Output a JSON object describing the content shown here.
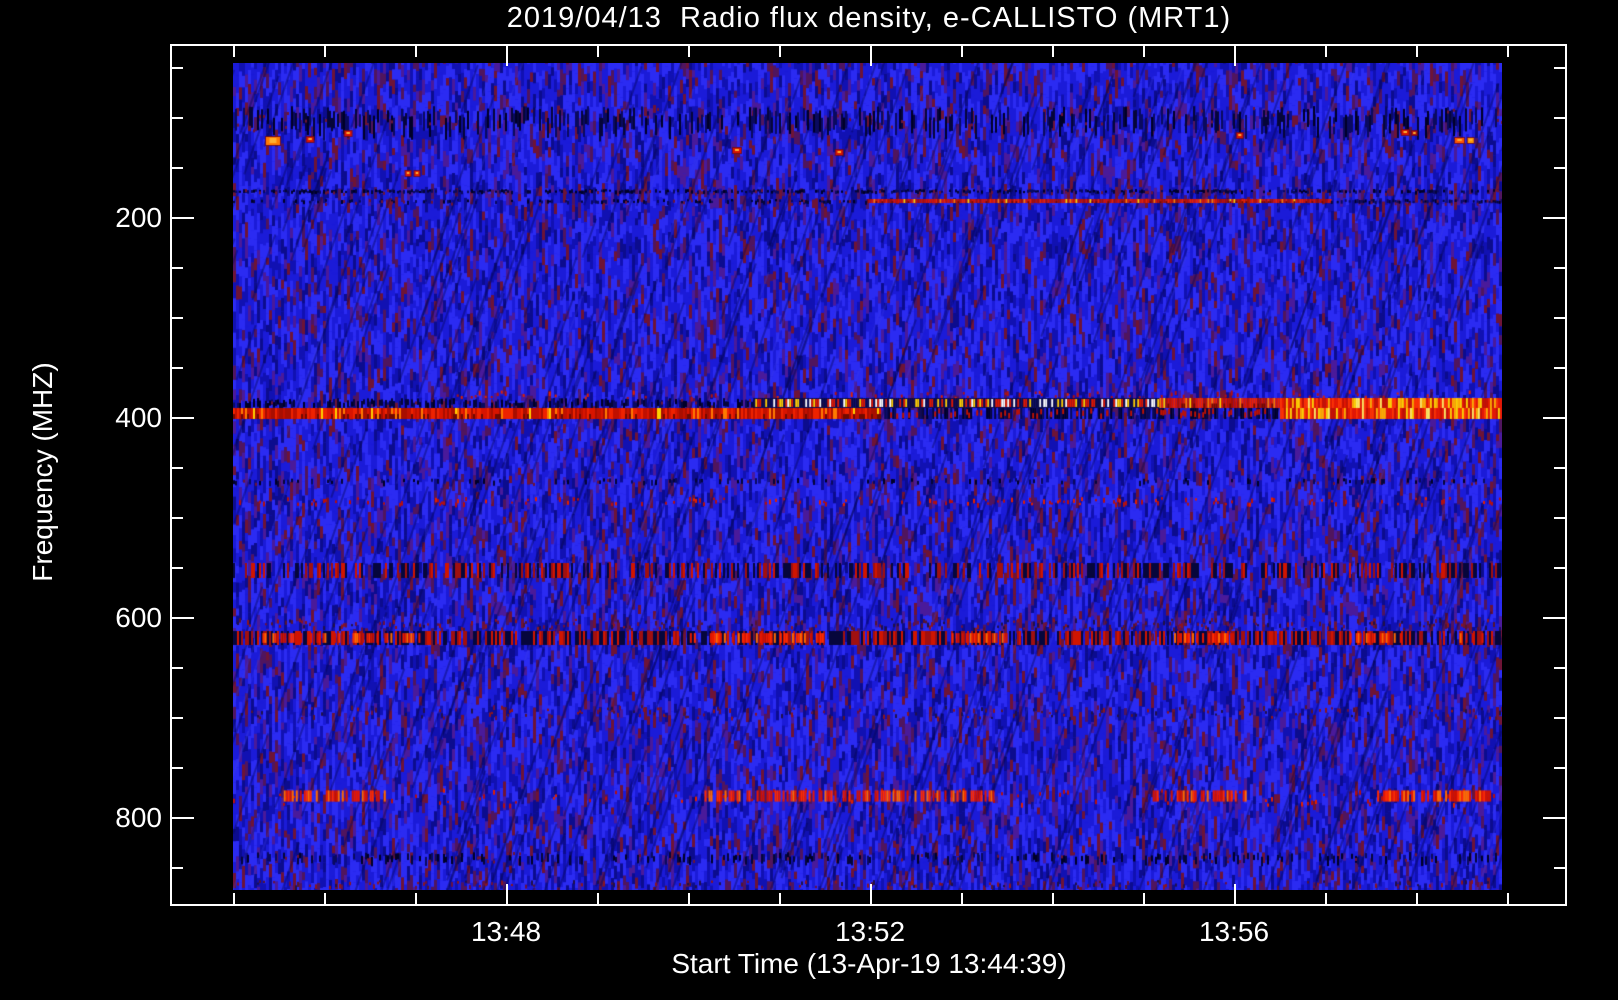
{
  "title": "2019/04/13  Radio flux density, e-CALLISTO (MRT1)",
  "axes": {
    "x": {
      "label": "Start Time (13-Apr-19 13:44:39)",
      "major_labels": [
        "13:48",
        "13:52",
        "13:56"
      ]
    },
    "y": {
      "label": "Frequency (MHZ)",
      "major_labels": [
        "200",
        "400",
        "600",
        "800"
      ]
    }
  },
  "chart_data": {
    "type": "heatmap",
    "title": "2019/04/13  Radio flux density, e-CALLISTO (MRT1)",
    "xlabel": "Start Time (13-Apr-19 13:44:39)",
    "ylabel": "Frequency (MHZ)",
    "instrument": "e-CALLISTO (MRT1)",
    "date": "2019/04/13",
    "start_time": "13:44:39",
    "x_axis": {
      "first_tick_label_time": "13:45",
      "num_minor_ticks": 15,
      "tick_interval_minutes": 1,
      "major_tick_indices": [
        3,
        7,
        11
      ],
      "major_tick_labels": [
        "13:48",
        "13:52",
        "13:56"
      ]
    },
    "y_axis": {
      "unit": "MHz",
      "min": 45,
      "max": 872,
      "inverted": true,
      "major_ticks": [
        200,
        400,
        600,
        800
      ],
      "minor_tick_step": 50,
      "minor_ticks": [
        50,
        100,
        150,
        250,
        300,
        350,
        450,
        500,
        550,
        650,
        700,
        750,
        850
      ]
    },
    "colormap": {
      "background_blue": "#1b1bd8",
      "bright_blue": "#2b2bf2",
      "dark_blue": "#0c0c8e",
      "purple_speckle": "#4a1a9a",
      "maroon_speckle": "#6a1040",
      "rfi_red": "#d81400",
      "rfi_orange": "#ff7a00",
      "rfi_yellow": "#ffd000",
      "rfi_white": "#ffffff"
    },
    "features": [
      {
        "label": "dark mottled band ~88-112 MHz",
        "freq_lo": 88,
        "freq_hi": 112,
        "segments": [
          {
            "x0": 0,
            "x1": 1,
            "style": "dark",
            "density": 0.42
          }
        ]
      },
      {
        "label": "faint dark line ~171 MHz",
        "freq_lo": 171,
        "freq_hi": 175,
        "segments": [
          {
            "x0": 0,
            "x1": 1,
            "style": "dark",
            "density": 0.5
          }
        ]
      },
      {
        "label": "RFI line ~182 MHz, bright red after 13:52",
        "freq_lo": 181,
        "freq_hi": 185,
        "segments": [
          {
            "x0": 0,
            "x1": 0.5,
            "style": "dark",
            "density": 0.3
          },
          {
            "x0": 0.5,
            "x1": 0.865,
            "style": "solid_red"
          },
          {
            "x0": 0.865,
            "x1": 1,
            "style": "dark",
            "density": 0.65
          }
        ]
      },
      {
        "label": "sparse red speckle ~372-379 MHz",
        "freq_lo": 372,
        "freq_hi": 379,
        "segments": [
          {
            "x0": 0.17,
            "x1": 1,
            "style": "red_speckle",
            "density": 0.14
          }
        ]
      },
      {
        "label": "strong RFI complex upper lane ~380-390 MHz",
        "freq_lo": 380,
        "freq_hi": 390,
        "segments": [
          {
            "x0": 0,
            "x1": 0.41,
            "style": "dark",
            "density": 0.6
          },
          {
            "x0": 0.41,
            "x1": 0.73,
            "style": "bright_mix"
          },
          {
            "x0": 0.73,
            "x1": 0.825,
            "style": "solid_red"
          },
          {
            "x0": 0.825,
            "x1": 1,
            "style": "red_yellow"
          }
        ]
      },
      {
        "label": "strong RFI complex lower lane ~390-401 MHz",
        "freq_lo": 390,
        "freq_hi": 401,
        "segments": [
          {
            "x0": 0,
            "x1": 0.51,
            "style": "solid_red"
          },
          {
            "x0": 0.51,
            "x1": 0.825,
            "style": "dark_redspeckle",
            "density": 0.55
          },
          {
            "x0": 0.825,
            "x1": 1,
            "style": "red_yellow"
          }
        ]
      },
      {
        "label": "faint dark line ~460 MHz",
        "freq_lo": 460,
        "freq_hi": 466,
        "segments": [
          {
            "x0": 0,
            "x1": 1,
            "style": "dark",
            "density": 0.18
          }
        ]
      },
      {
        "label": "red speckle line ~480 MHz",
        "freq_lo": 479,
        "freq_hi": 485,
        "segments": [
          {
            "x0": 0,
            "x1": 1,
            "style": "red_speckle",
            "density": 0.18
          }
        ]
      },
      {
        "label": "speckled RFI band ~545-560 MHz",
        "freq_lo": 545,
        "freq_hi": 560,
        "segments": [
          {
            "x0": 0,
            "x1": 1,
            "style": "dark_red_mix",
            "density": 0.5
          }
        ]
      },
      {
        "label": "maroon speckle ~600-610 MHz",
        "freq_lo": 600,
        "freq_hi": 610,
        "segments": [
          {
            "x0": 0,
            "x1": 1,
            "style": "maroon_speckle",
            "density": 0.35
          }
        ]
      },
      {
        "label": "strong speckled RFI band ~613-627 MHz",
        "freq_lo": 613,
        "freq_hi": 627,
        "clusters": [
          [
            0.02,
            0.15
          ],
          [
            0.36,
            0.47
          ],
          [
            0.56,
            0.61
          ],
          [
            0.74,
            0.79
          ],
          [
            0.88,
            0.92
          ],
          [
            0.965,
            0.985
          ]
        ],
        "segments": [
          {
            "x0": 0,
            "x1": 1,
            "style": "dark_red_mix",
            "density": 0.75
          }
        ]
      },
      {
        "label": "faint speckle ~687-699 MHz",
        "freq_lo": 687,
        "freq_hi": 699,
        "segments": [
          {
            "x0": 0,
            "x1": 1,
            "style": "maroon_speckle",
            "density": 0.28
          }
        ]
      },
      {
        "label": "red blob band ~770-786 MHz",
        "freq_lo": 770,
        "freq_hi": 786,
        "clusters": [
          [
            0.04,
            0.12
          ],
          [
            0.37,
            0.6
          ],
          [
            0.72,
            0.8
          ],
          [
            0.9,
            0.99
          ]
        ],
        "segments": [
          {
            "x0": 0,
            "x1": 1,
            "style": "red_speckle",
            "density": 0.12
          }
        ]
      },
      {
        "label": "dark band ~834-844 MHz",
        "freq_lo": 834,
        "freq_hi": 844,
        "segments": [
          {
            "x0": 0,
            "x1": 1,
            "style": "dark",
            "density": 0.3
          }
        ]
      },
      {
        "label": "bottom speckle ~862-868 MHz",
        "freq_lo": 862,
        "freq_hi": 868,
        "segments": [
          {
            "x0": 0,
            "x1": 1,
            "style": "maroon_speckle",
            "density": 0.22
          }
        ]
      }
    ],
    "spots": [
      {
        "x": 0.026,
        "freq": 119,
        "color": "#ff7a00",
        "w": 14,
        "h": 8
      },
      {
        "x": 0.058,
        "freq": 119,
        "color": "#d81400",
        "w": 7,
        "h": 5
      },
      {
        "x": 0.088,
        "freq": 113,
        "color": "#d81400",
        "w": 7,
        "h": 5
      },
      {
        "x": 0.136,
        "freq": 153,
        "color": "#e02000",
        "w": 5,
        "h": 5
      },
      {
        "x": 0.143,
        "freq": 153,
        "color": "#e02000",
        "w": 5,
        "h": 5
      },
      {
        "x": 0.394,
        "freq": 130,
        "color": "#d81400",
        "w": 8,
        "h": 5
      },
      {
        "x": 0.475,
        "freq": 132,
        "color": "#d81400",
        "w": 7,
        "h": 5
      },
      {
        "x": 0.791,
        "freq": 115,
        "color": "#d81400",
        "w": 6,
        "h": 5
      },
      {
        "x": 0.921,
        "freq": 112,
        "color": "#d81400",
        "w": 7,
        "h": 5
      },
      {
        "x": 0.929,
        "freq": 113,
        "color": "#b01010",
        "w": 5,
        "h": 4
      },
      {
        "x": 0.963,
        "freq": 120,
        "color": "#ff5500",
        "w": 9,
        "h": 5
      },
      {
        "x": 0.973,
        "freq": 120,
        "color": "#ff9900",
        "w": 6,
        "h": 5
      }
    ]
  }
}
